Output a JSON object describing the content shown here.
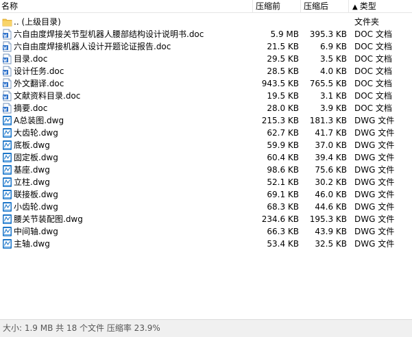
{
  "columns": {
    "name": "名称",
    "compressed": "压缩前",
    "original": "压缩后",
    "type": "类型",
    "sort_arrow": "▲"
  },
  "parent_row": {
    "name": ".. (上级目录)",
    "type": "文件夹",
    "icon": "folder-icon"
  },
  "files": [
    {
      "name": "六自由度焊接关节型机器人腰部结构设计说明书.doc",
      "size_before": "5.9 MB",
      "size_after": "395.3 KB",
      "type": "DOC 文档",
      "icon": "doc-icon"
    },
    {
      "name": "六自由度焊接机器人设计开题论证报告.doc",
      "size_before": "21.5 KB",
      "size_after": "6.9 KB",
      "type": "DOC 文档",
      "icon": "doc-icon"
    },
    {
      "name": "目录.doc",
      "size_before": "29.5 KB",
      "size_after": "3.5 KB",
      "type": "DOC 文档",
      "icon": "doc-icon"
    },
    {
      "name": "设计任务.doc",
      "size_before": "28.5 KB",
      "size_after": "4.0 KB",
      "type": "DOC 文档",
      "icon": "doc-icon"
    },
    {
      "name": "外文翻译.doc",
      "size_before": "943.5 KB",
      "size_after": "765.5 KB",
      "type": "DOC 文档",
      "icon": "doc-icon"
    },
    {
      "name": "文献资料目录.doc",
      "size_before": "19.5 KB",
      "size_after": "3.1 KB",
      "type": "DOC 文档",
      "icon": "doc-icon"
    },
    {
      "name": "摘要.doc",
      "size_before": "28.0 KB",
      "size_after": "3.9 KB",
      "type": "DOC 文档",
      "icon": "doc-icon"
    },
    {
      "name": "A总装图.dwg",
      "size_before": "215.3 KB",
      "size_after": "181.3 KB",
      "type": "DWG 文件",
      "icon": "dwg-icon"
    },
    {
      "name": "大齿轮.dwg",
      "size_before": "62.7 KB",
      "size_after": "41.7 KB",
      "type": "DWG 文件",
      "icon": "dwg-icon"
    },
    {
      "name": "底板.dwg",
      "size_before": "59.9 KB",
      "size_after": "37.0 KB",
      "type": "DWG 文件",
      "icon": "dwg-icon"
    },
    {
      "name": "固定板.dwg",
      "size_before": "60.4 KB",
      "size_after": "39.4 KB",
      "type": "DWG 文件",
      "icon": "dwg-icon"
    },
    {
      "name": "基座.dwg",
      "size_before": "98.6 KB",
      "size_after": "75.6 KB",
      "type": "DWG 文件",
      "icon": "dwg-icon"
    },
    {
      "name": "立柱.dwg",
      "size_before": "52.1 KB",
      "size_after": "30.2 KB",
      "type": "DWG 文件",
      "icon": "dwg-icon"
    },
    {
      "name": "联接板.dwg",
      "size_before": "69.1 KB",
      "size_after": "46.0 KB",
      "type": "DWG 文件",
      "icon": "dwg-icon"
    },
    {
      "name": "小齿轮.dwg",
      "size_before": "68.3 KB",
      "size_after": "44.6 KB",
      "type": "DWG 文件",
      "icon": "dwg-icon"
    },
    {
      "name": "腰关节装配图.dwg",
      "size_before": "234.6 KB",
      "size_after": "195.3 KB",
      "type": "DWG 文件",
      "icon": "dwg-icon"
    },
    {
      "name": "中间轴.dwg",
      "size_before": "66.3 KB",
      "size_after": "43.9 KB",
      "type": "DWG 文件",
      "icon": "dwg-icon"
    },
    {
      "name": "主轴.dwg",
      "size_before": "53.4 KB",
      "size_after": "32.5 KB",
      "type": "DWG 文件",
      "icon": "dwg-icon"
    }
  ],
  "status": "大小: 1.9 MB 共 18 个文件 压缩率 23.9%",
  "colors": {
    "folder": "#f5c64a",
    "doc_blue": "#2a6fc9",
    "dwg_blue": "#1b75c8"
  }
}
